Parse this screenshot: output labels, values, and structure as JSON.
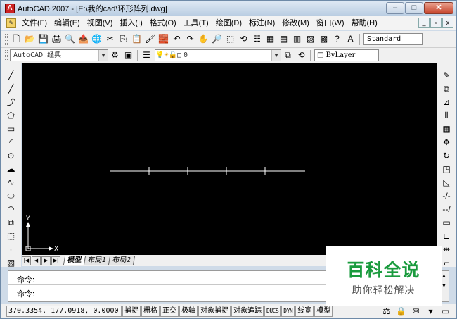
{
  "window": {
    "title": "AutoCAD 2007 - [E:\\我的cad\\环形阵列.dwg]",
    "app_icon_text": "A",
    "min": "–",
    "max": "□",
    "close": "✕"
  },
  "menu": {
    "items": [
      "文件(F)",
      "编辑(E)",
      "视图(V)",
      "插入(I)",
      "格式(O)",
      "工具(T)",
      "绘图(D)",
      "标注(N)",
      "修改(M)",
      "窗口(W)",
      "帮助(H)"
    ],
    "mdi_min": "_",
    "mdi_restore": "▫",
    "mdi_close": "x"
  },
  "toolbar1": {
    "icons": [
      "new-icon",
      "open-icon",
      "save-icon",
      "plot-icon",
      "plot-preview-icon",
      "publish-icon",
      "dwf-icon",
      "cut-icon",
      "copy-icon",
      "paste-icon",
      "match-properties-icon",
      "block-editor-icon",
      "undo-icon",
      "redo-icon",
      "pan-icon",
      "zoom-realtime-icon",
      "zoom-window-icon",
      "zoom-previous-icon",
      "properties-icon",
      "design-center-icon",
      "tool-palettes-icon",
      "sheet-set-icon",
      "markup-icon",
      "calculator-icon",
      "help-icon",
      "text-style-icon"
    ],
    "glyphs": [
      "🗋",
      "📂",
      "💾",
      "🖨",
      "🔍",
      "📤",
      "🌐",
      "✂",
      "⎘",
      "📋",
      "🖌",
      "🧱",
      "↶",
      "↷",
      "✋",
      "🔎",
      "⬚",
      "⟲",
      "☷",
      "▦",
      "▤",
      "▥",
      "▨",
      "▩",
      "?",
      "A"
    ],
    "text_style_value": "Standard"
  },
  "toolbar2": {
    "workspace": "AutoCAD 经典",
    "layer_value": "0",
    "color_value": "ByLayer"
  },
  "left_tools": {
    "icons": [
      "line-icon",
      "construction-line-icon",
      "polyline-icon",
      "polygon-icon",
      "rectangle-icon",
      "arc-icon",
      "circle-icon",
      "revision-cloud-icon",
      "spline-icon",
      "ellipse-icon",
      "ellipse-arc-icon",
      "insert-block-icon",
      "make-block-icon",
      "point-icon",
      "hatch-icon"
    ],
    "glyphs": [
      "╱",
      "╱",
      "⤴",
      "⬠",
      "▭",
      "◜",
      "⊙",
      "☁",
      "∿",
      "⬭",
      "◠",
      "⧉",
      "⬚",
      "·",
      "▨"
    ]
  },
  "right_tools": {
    "icons": [
      "erase-icon",
      "copy-object-icon",
      "mirror-icon",
      "offset-icon",
      "array-icon",
      "move-icon",
      "rotate-icon",
      "scale-icon",
      "stretch-icon",
      "trim-icon",
      "extend-icon",
      "break-icon",
      "join-icon",
      "chamfer-icon",
      "fillet-icon"
    ],
    "glyphs": [
      "✎",
      "⧉",
      "⊿",
      "⫴",
      "▦",
      "✥",
      "↻",
      "◳",
      "◺",
      "-/-",
      "--/",
      "▭",
      "⊏",
      "⇹",
      "⌐"
    ]
  },
  "drawing": {
    "ucs_y": "Y",
    "ucs_x": "X"
  },
  "layout_tabs": {
    "nav": [
      "|◀",
      "◀",
      "▶",
      "▶|"
    ],
    "tabs": [
      "模型",
      "布局1",
      "布局2"
    ]
  },
  "command": {
    "line1": "命令:",
    "line2": "命令:"
  },
  "status": {
    "coords": "370.3354, 177.0918, 0.0000",
    "buttons": [
      "捕捉",
      "栅格",
      "正交",
      "极轴",
      "对象捕捉",
      "对象追踪",
      "DUCS",
      "DYN",
      "线宽",
      "模型"
    ]
  },
  "watermark": {
    "brand": "百科全说",
    "tagline": "助你轻松解决"
  },
  "colors": {
    "canvas_bg": "#000000",
    "watermark_green": "#1a9b3e"
  }
}
